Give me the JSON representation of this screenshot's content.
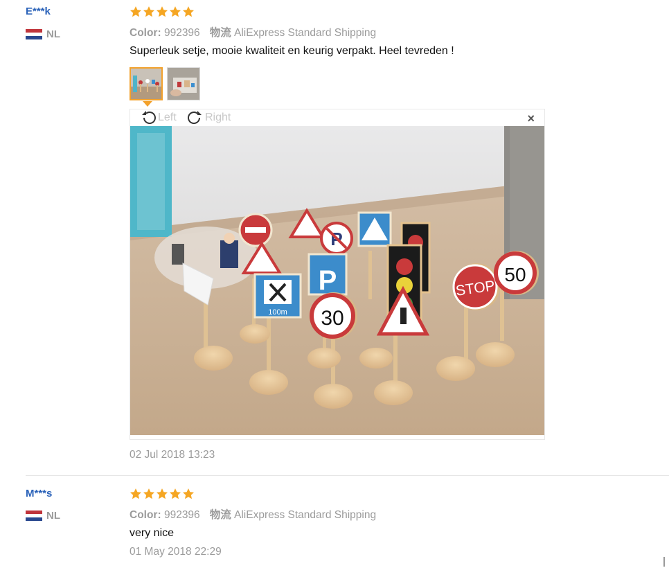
{
  "reviews": [
    {
      "buyer": "E***k",
      "country": "NL",
      "rating": 5,
      "color_label": "Color:",
      "color_value": "992396",
      "shipping_label": "物流",
      "shipping_value": "AliExpress Standard Shipping",
      "text": "Superleuk setje, mooie kwaliteit en keurig verpakt. Heel tevreden !",
      "date": "02 Jul 2018 13:23",
      "viewer": {
        "rotate_left": "Left",
        "rotate_right": "Right",
        "close": "×"
      },
      "photo_signs": {
        "speed_30": "30",
        "speed_50": "50",
        "stop": "STOP",
        "parking": "P",
        "distance": "100m"
      }
    },
    {
      "buyer": "M***s",
      "country": "NL",
      "rating": 5,
      "color_label": "Color:",
      "color_value": "992396",
      "shipping_label": "物流",
      "shipping_value": "AliExpress Standard Shipping",
      "text": "very nice",
      "date": "01 May 2018 22:29"
    }
  ],
  "colors": {
    "buyer_link": "#2a62b9",
    "star": "#f5a623",
    "active_thumb": "#f3a12b",
    "meta_text": "#9b9b9b"
  }
}
